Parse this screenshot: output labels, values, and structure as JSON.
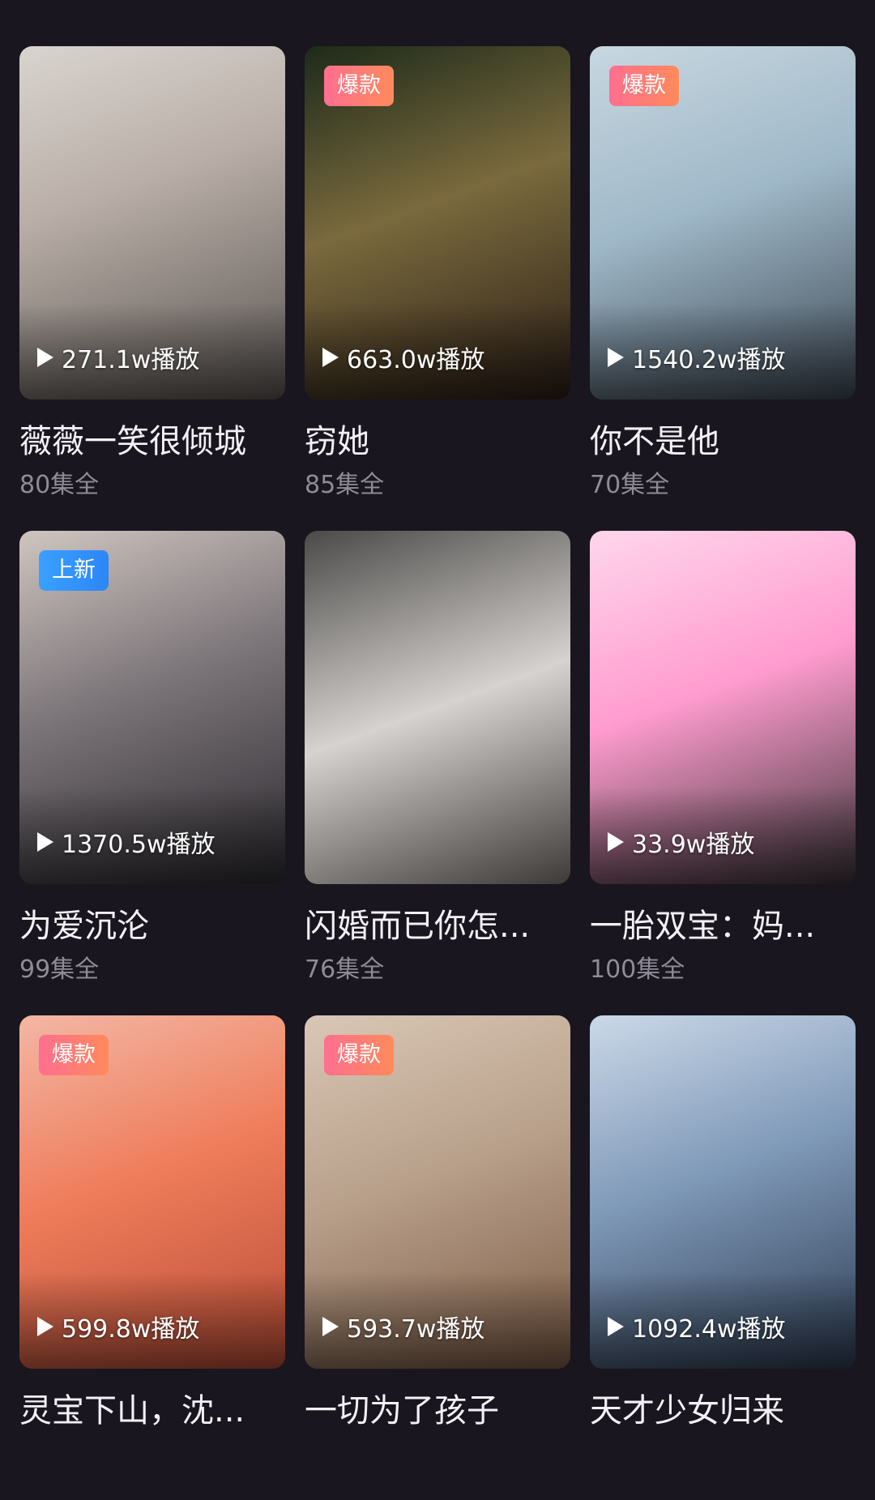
{
  "dramas": [
    {
      "title": "薇薇一笑很倾城",
      "episodes": "80集全",
      "plays": "271.1w播放",
      "badge": ""
    },
    {
      "title": "窃她",
      "episodes": "85集全",
      "plays": "663.0w播放",
      "badge": "爆款"
    },
    {
      "title": "你不是他",
      "episodes": "70集全",
      "plays": "1540.2w播放",
      "badge": "爆款"
    },
    {
      "title": "为爱沉沦",
      "episodes": "99集全",
      "plays": "1370.5w播放",
      "badge": "上新"
    },
    {
      "title": "闪婚而已你怎...",
      "episodes": "76集全",
      "plays": "",
      "badge": ""
    },
    {
      "title": "一胎双宝：妈...",
      "episodes": "100集全",
      "plays": "33.9w播放",
      "badge": ""
    },
    {
      "title": "灵宝下山，沈...",
      "episodes": "",
      "plays": "599.8w播放",
      "badge": "爆款"
    },
    {
      "title": "一切为了孩子",
      "episodes": "",
      "plays": "593.7w播放",
      "badge": "爆款"
    },
    {
      "title": "天才少女归来",
      "episodes": "",
      "plays": "1092.4w播放",
      "badge": ""
    }
  ],
  "badge_colors": {
    "hot": "#ff6f8f",
    "new": "#3aa0ff"
  }
}
